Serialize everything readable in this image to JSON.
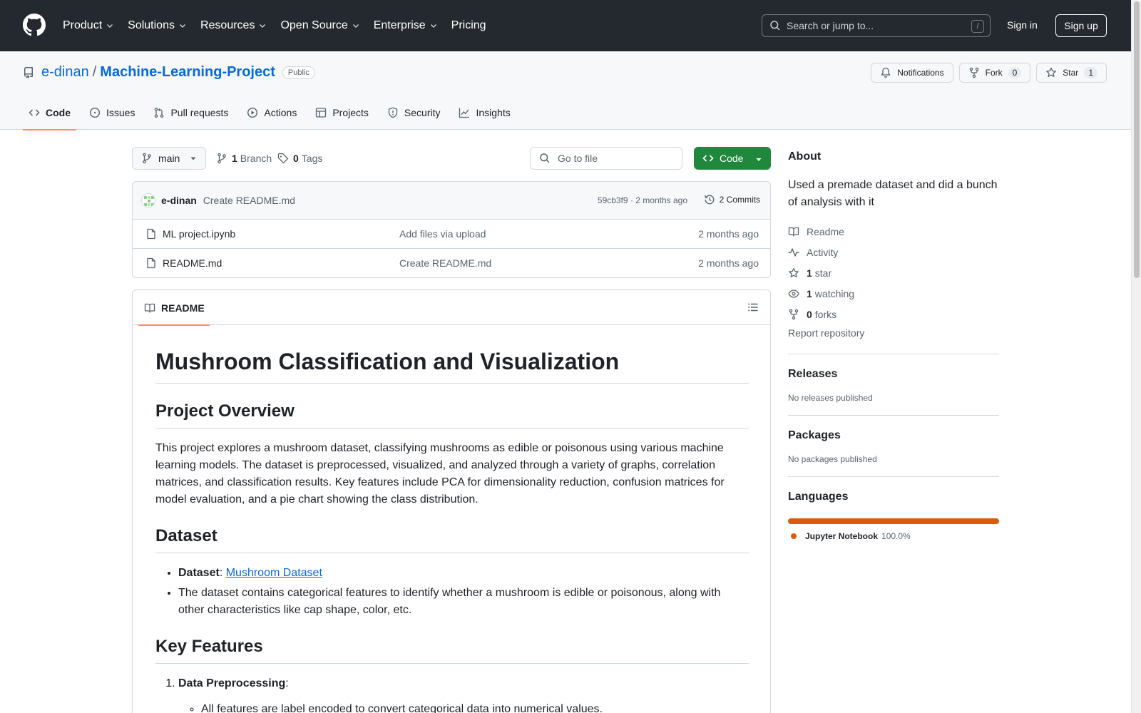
{
  "header": {
    "nav": [
      {
        "label": "Product",
        "dropdown": true
      },
      {
        "label": "Solutions",
        "dropdown": true
      },
      {
        "label": "Resources",
        "dropdown": true
      },
      {
        "label": "Open Source",
        "dropdown": true
      },
      {
        "label": "Enterprise",
        "dropdown": true
      },
      {
        "label": "Pricing",
        "dropdown": false
      }
    ],
    "search_placeholder": "Search or jump to...",
    "search_shortcut": "/",
    "sign_in": "Sign in",
    "sign_up": "Sign up"
  },
  "repo": {
    "owner": "e-dinan",
    "separator": "/",
    "name": "Machine-Learning-Project",
    "visibility": "Public",
    "actions": {
      "notifications": "Notifications",
      "fork": "Fork",
      "fork_count": "0",
      "star": "Star",
      "star_count": "1"
    },
    "tabs": [
      {
        "label": "Code",
        "icon": "code-icon",
        "active": true
      },
      {
        "label": "Issues",
        "icon": "issue-icon",
        "active": false
      },
      {
        "label": "Pull requests",
        "icon": "pull-request-icon",
        "active": false
      },
      {
        "label": "Actions",
        "icon": "play-icon",
        "active": false
      },
      {
        "label": "Projects",
        "icon": "table-icon",
        "active": false
      },
      {
        "label": "Security",
        "icon": "shield-icon",
        "active": false
      },
      {
        "label": "Insights",
        "icon": "graph-icon",
        "active": false
      }
    ]
  },
  "toolbar": {
    "branch": "main",
    "branch_count": "1",
    "branch_label": "Branch",
    "tag_count": "0",
    "tag_label": "Tags",
    "goto_placeholder": "Go to file",
    "code_button": "Code"
  },
  "latest_commit": {
    "author": "e-dinan",
    "message": "Create README.md",
    "meta": "59cb3f9 · 2 months ago",
    "commits": "2 Commits"
  },
  "files": [
    {
      "name": "ML project.ipynb",
      "message": "Add files via upload",
      "time": "2 months ago"
    },
    {
      "name": "README.md",
      "message": "Create README.md",
      "time": "2 months ago"
    }
  ],
  "readme": {
    "tab": "README",
    "h1": "Mushroom Classification and Visualization",
    "overview_h": "Project Overview",
    "overview_p": "This project explores a mushroom dataset, classifying mushrooms as edible or poisonous using various machine learning models. The dataset is preprocessed, visualized, and analyzed through a variety of graphs, correlation matrices, and classification results. Key features include PCA for dimensionality reduction, confusion matrices for model evaluation, and a pie chart showing the class distribution.",
    "dataset_h": "Dataset",
    "dataset_label": "Dataset",
    "dataset_colon": ":",
    "dataset_link": "Mushroom Dataset",
    "dataset_desc": "The dataset contains categorical features to identify whether a mushroom is edible or poisonous, along with other characteristics like cap shape, color, etc.",
    "features_h": "Key Features",
    "feature1_label": "Data Preprocessing",
    "feature1_colon": ":",
    "feature1_sub1": "All features are label encoded to convert categorical data into numerical values."
  },
  "sidebar": {
    "about_h": "About",
    "about_desc": "Used a premade dataset and did a bunch of analysis with it",
    "readme": "Readme",
    "activity": "Activity",
    "stars_count": "1",
    "stars_label": "star",
    "watching_count": "1",
    "watching_label": "watching",
    "forks_count": "0",
    "forks_label": "forks",
    "report": "Report repository",
    "releases_h": "Releases",
    "releases_sub": "No releases published",
    "packages_h": "Packages",
    "packages_sub": "No packages published",
    "languages_h": "Languages",
    "language": {
      "name": "Jupyter Notebook",
      "percent": "100.0%",
      "share": 1.0,
      "color": "#DA5B0B"
    }
  },
  "colors": {
    "header_bg": "#24292f",
    "link": "#0969da",
    "code_button": "#1f883d",
    "active_tab_underline": "#fd8c73"
  }
}
